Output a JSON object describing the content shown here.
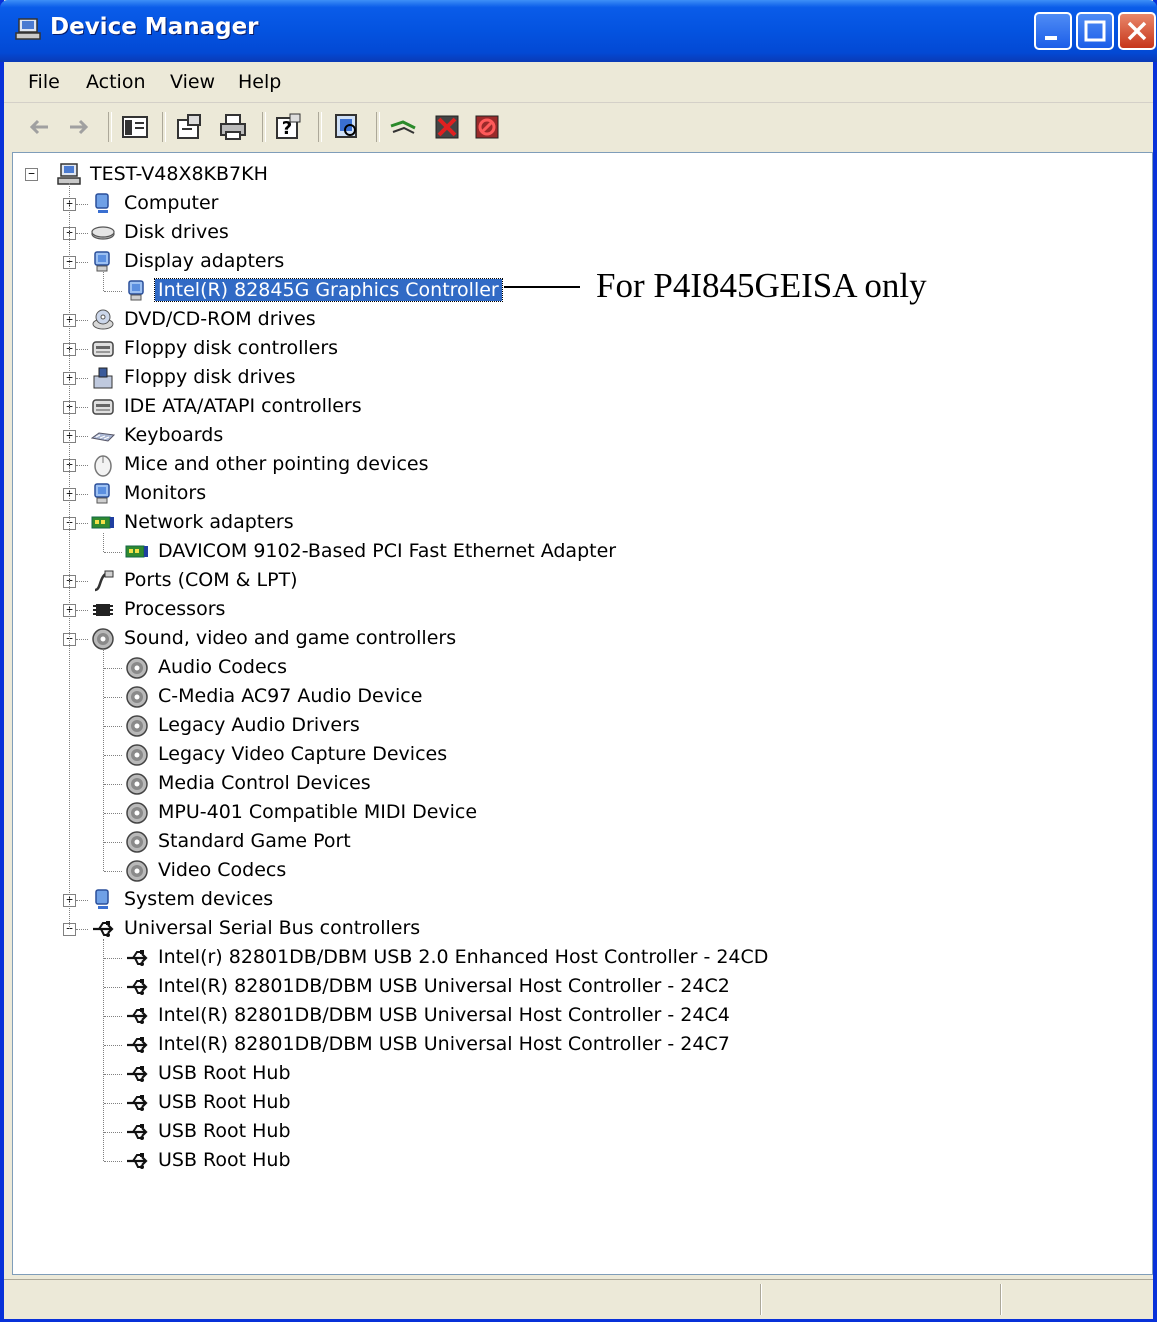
{
  "window": {
    "title": "Device Manager"
  },
  "menu": [
    "File",
    "Action",
    "View",
    "Help"
  ],
  "toolbar": [
    "back-icon",
    "forward-icon",
    "show-hide-tree-icon",
    "properties-icon",
    "print-icon",
    "help-icon",
    "scan-hardware-icon",
    "update-driver-icon",
    "uninstall-icon",
    "disable-icon"
  ],
  "tree": {
    "root": "TEST-V48X8KB7KH",
    "rows": [
      {
        "label": "Computer",
        "level": 1,
        "state": "collapsed",
        "icon": "computer-icon"
      },
      {
        "label": "Disk drives",
        "level": 1,
        "state": "collapsed",
        "icon": "disk-drive-icon"
      },
      {
        "label": "Display adapters",
        "level": 1,
        "state": "expanded",
        "icon": "monitor-icon"
      },
      {
        "label": "Intel(R) 82845G Graphics Controller",
        "level": 2,
        "icon": "monitor-icon",
        "selected": true
      },
      {
        "label": "DVD/CD-ROM drives",
        "level": 1,
        "state": "collapsed",
        "icon": "cdrom-icon"
      },
      {
        "label": "Floppy disk controllers",
        "level": 1,
        "state": "collapsed",
        "icon": "controller-icon"
      },
      {
        "label": "Floppy disk drives",
        "level": 1,
        "state": "collapsed",
        "icon": "floppy-icon"
      },
      {
        "label": "IDE ATA/ATAPI controllers",
        "level": 1,
        "state": "collapsed",
        "icon": "controller-icon"
      },
      {
        "label": "Keyboards",
        "level": 1,
        "state": "collapsed",
        "icon": "keyboard-icon"
      },
      {
        "label": "Mice and other pointing devices",
        "level": 1,
        "state": "collapsed",
        "icon": "mouse-icon"
      },
      {
        "label": "Monitors",
        "level": 1,
        "state": "collapsed",
        "icon": "monitor-icon"
      },
      {
        "label": "Network adapters",
        "level": 1,
        "state": "expanded",
        "icon": "network-card-icon"
      },
      {
        "label": "DAVICOM 9102-Based PCI Fast Ethernet Adapter",
        "level": 2,
        "icon": "network-card-icon"
      },
      {
        "label": "Ports (COM & LPT)",
        "level": 1,
        "state": "collapsed",
        "icon": "port-icon"
      },
      {
        "label": "Processors",
        "level": 1,
        "state": "collapsed",
        "icon": "processor-icon"
      },
      {
        "label": "Sound, video and game controllers",
        "level": 1,
        "state": "expanded",
        "icon": "speaker-icon"
      },
      {
        "label": "Audio Codecs",
        "level": 2,
        "icon": "speaker-icon"
      },
      {
        "label": "C-Media AC97 Audio Device",
        "level": 2,
        "icon": "speaker-icon"
      },
      {
        "label": "Legacy Audio Drivers",
        "level": 2,
        "icon": "speaker-icon"
      },
      {
        "label": "Legacy Video Capture Devices",
        "level": 2,
        "icon": "speaker-icon"
      },
      {
        "label": "Media Control Devices",
        "level": 2,
        "icon": "speaker-icon"
      },
      {
        "label": "MPU-401 Compatible MIDI Device",
        "level": 2,
        "icon": "speaker-icon"
      },
      {
        "label": "Standard Game Port",
        "level": 2,
        "icon": "speaker-icon"
      },
      {
        "label": "Video Codecs",
        "level": 2,
        "icon": "speaker-icon"
      },
      {
        "label": "System devices",
        "level": 1,
        "state": "collapsed",
        "icon": "computer-icon"
      },
      {
        "label": "Universal Serial Bus controllers",
        "level": 1,
        "state": "expanded",
        "icon": "usb-icon"
      },
      {
        "label": "Intel(r) 82801DB/DBM USB 2.0 Enhanced Host Controller - 24CD",
        "level": 2,
        "icon": "usb-icon"
      },
      {
        "label": "Intel(R) 82801DB/DBM USB Universal Host Controller - 24C2",
        "level": 2,
        "icon": "usb-icon"
      },
      {
        "label": "Intel(R) 82801DB/DBM USB Universal Host Controller - 24C4",
        "level": 2,
        "icon": "usb-icon"
      },
      {
        "label": "Intel(R) 82801DB/DBM USB Universal Host Controller - 24C7",
        "level": 2,
        "icon": "usb-icon"
      },
      {
        "label": "USB Root Hub",
        "level": 2,
        "icon": "usb-icon"
      },
      {
        "label": "USB Root Hub",
        "level": 2,
        "icon": "usb-icon"
      },
      {
        "label": "USB Root Hub",
        "level": 2,
        "icon": "usb-icon"
      },
      {
        "label": "USB Root Hub",
        "level": 2,
        "icon": "usb-icon"
      }
    ]
  },
  "annotation": "For P4I845GEISA only",
  "colors": {
    "titlebar": "#0453e0",
    "selection": "#316ac5",
    "close_button": "#c7361a"
  }
}
